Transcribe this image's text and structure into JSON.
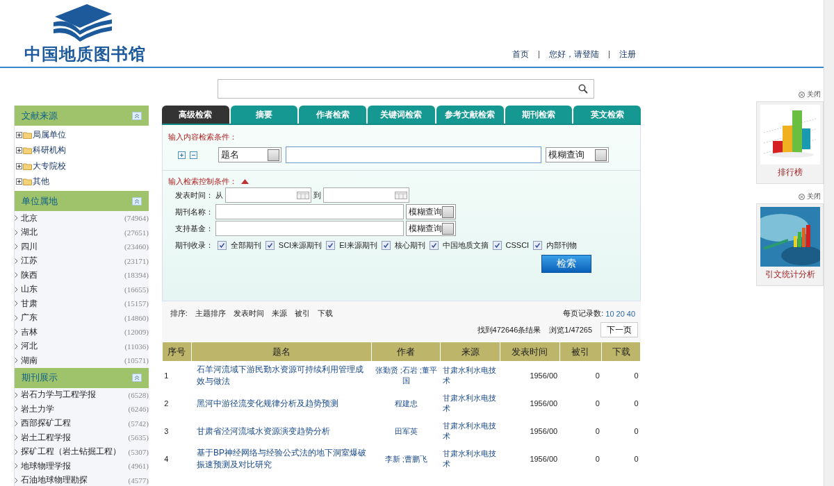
{
  "header": {
    "logo_text": "中国地质图书馆",
    "nav": [
      "首页",
      "您好，请登陆",
      "注册"
    ]
  },
  "sidebar": {
    "sections": [
      {
        "title": "文献来源",
        "kind": "tree",
        "items": [
          {
            "label": "局属单位",
            "expanded": false
          },
          {
            "label": "科研机构",
            "expanded": false
          },
          {
            "label": "大专院校",
            "expanded": false
          },
          {
            "label": "其他",
            "expanded": false
          }
        ]
      },
      {
        "title": "单位属地",
        "kind": "list",
        "items": [
          {
            "label": "北京",
            "count": "(74964)"
          },
          {
            "label": "湖北",
            "count": "(27651)"
          },
          {
            "label": "四川",
            "count": "(23460)"
          },
          {
            "label": "江苏",
            "count": "(23171)"
          },
          {
            "label": "陕西",
            "count": "(18394)"
          },
          {
            "label": "山东",
            "count": "(16655)"
          },
          {
            "label": "甘肃",
            "count": "(15157)"
          },
          {
            "label": "广东",
            "count": "(14860)"
          },
          {
            "label": "吉林",
            "count": "(12009)"
          },
          {
            "label": "河北",
            "count": "(11036)"
          },
          {
            "label": "湖南",
            "count": "(10571)"
          }
        ]
      },
      {
        "title": "期刊展示",
        "kind": "list",
        "items": [
          {
            "label": "岩石力学与工程学报",
            "count": "(6528)"
          },
          {
            "label": "岩土力学",
            "count": "(6246)"
          },
          {
            "label": "西部探矿工程",
            "count": "(5742)"
          },
          {
            "label": "岩土工程学报",
            "count": "(5635)"
          },
          {
            "label": "探矿工程（岩土钻掘工程）",
            "count": "(5307)"
          },
          {
            "label": "地球物理学报",
            "count": "(4961)"
          },
          {
            "label": "石油地球物理勘探",
            "count": "(4577)"
          }
        ]
      }
    ]
  },
  "tabs": [
    {
      "label": "高级检索",
      "selected": true
    },
    {
      "label": "摘要",
      "selected": false
    },
    {
      "label": "作者检索",
      "selected": false
    },
    {
      "label": "关键词检索",
      "selected": false
    },
    {
      "label": "参考文献检索",
      "selected": false
    },
    {
      "label": "期刊检索",
      "selected": false
    },
    {
      "label": "英文检索",
      "selected": false
    }
  ],
  "content_conditions": {
    "label": "输入内容检索条件：",
    "field_select": "题名",
    "match_select": "模糊查询"
  },
  "control_conditions": {
    "label": "输入检索控制条件：",
    "date_label": "发表时间：",
    "from": "从",
    "to": "到",
    "journal_label": "期刊名称：",
    "journal_match": "模糊查询",
    "fund_label": "支持基金：",
    "fund_match": "模糊查询",
    "collection_label": "期刊收录：",
    "collections": [
      {
        "label": "全部期刊",
        "checked": true
      },
      {
        "label": "SCI来源期刊",
        "checked": true
      },
      {
        "label": "EI来源期刊",
        "checked": true
      },
      {
        "label": "核心期刊",
        "checked": true
      },
      {
        "label": "中国地质文摘",
        "checked": true
      },
      {
        "label": "CSSCI",
        "checked": true
      },
      {
        "label": "内部刊物",
        "checked": true
      }
    ],
    "search_button": "检索"
  },
  "results": {
    "sort_label": "排序:",
    "sort_options": [
      "主题排序",
      "发表时间",
      "来源",
      "被引",
      "下载"
    ],
    "per_page_label": "每页记录数:",
    "per_page_options": [
      "10",
      "20",
      "40"
    ],
    "found": "找到472646条结果",
    "browse": "浏览1/47265",
    "next_button": "下一页",
    "table": {
      "columns": [
        "序号",
        "题名",
        "作者",
        "来源",
        "发表时间",
        "被引",
        "下载"
      ],
      "rows": [
        {
          "no": "1",
          "title": "石羊河流域下游民勤水资源可持续利用管理成效与做法",
          "author": "张勤贤 ;石岩 ;董平国",
          "source": "甘肃水利水电技术",
          "date": "1956/00",
          "cited": "0",
          "downloads": "0"
        },
        {
          "no": "2",
          "title": "黑河中游径流变化规律分析及趋势预测",
          "author": "程建忠",
          "source": "甘肃水利水电技术",
          "date": "1956/00",
          "cited": "0",
          "downloads": "0"
        },
        {
          "no": "3",
          "title": "甘肃省泾河流域水资源演变趋势分析",
          "author": "田军英",
          "source": "甘肃水利水电技术",
          "date": "1956/00",
          "cited": "0",
          "downloads": "0"
        },
        {
          "no": "4",
          "title": "基于BP神经网络与经验公式法的地下洞室爆破振速预测及对比研究",
          "author": "李新 ;曹鹏飞",
          "source": "甘肃水利水电技术",
          "date": "1956/00",
          "cited": "0",
          "downloads": "0"
        }
      ]
    }
  },
  "widgets": [
    {
      "close": "关闭",
      "caption": "排行榜",
      "kind": "picture"
    },
    {
      "close": "关闭",
      "caption": "引文统计分析",
      "kind": "picture"
    }
  ]
}
